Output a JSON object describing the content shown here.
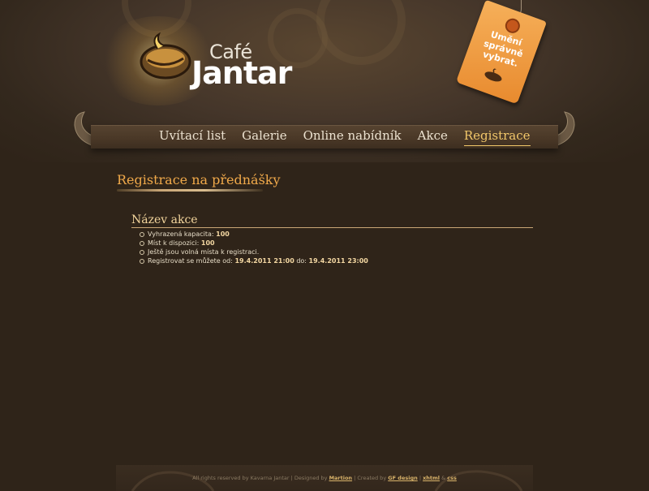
{
  "brand": {
    "small": "Café",
    "big": "Jantar"
  },
  "tag": {
    "line1": "Umění",
    "line2": "správně",
    "line3": "vybrat."
  },
  "nav": {
    "items": [
      {
        "label": "Uvítací list",
        "active": false
      },
      {
        "label": "Galerie",
        "active": false
      },
      {
        "label": "Online nabídník",
        "active": false
      },
      {
        "label": "Akce",
        "active": false
      },
      {
        "label": "Registrace",
        "active": true
      }
    ]
  },
  "main": {
    "page_title": "Registrace na přednášky",
    "event": {
      "title": "Název akce",
      "capacity_label": "Vyhrazená kapacita:",
      "capacity_value": "100",
      "free_label": "Míst k dispozici:",
      "free_value": "100",
      "status_text": "Ještě jsou volná místa k registraci.",
      "register_label": "Registrovat se můžete od:",
      "from_value": "19.4.2011 21:00",
      "to_label": "do:",
      "to_value": "19.4.2011 23:00"
    }
  },
  "footer": {
    "rights": "All rights reserved by Kavarna Jantar | Designed by",
    "designer": "Martion",
    "created_by": "| Created by",
    "creator": "GF design",
    "sep": "|",
    "xhtml": "xhtml",
    "amp": "&",
    "css": "css"
  },
  "colors": {
    "background": "#2f2419",
    "accent_orange": "#f0a94a",
    "active_nav": "#f2c76a",
    "tag_orange": "#f0a040"
  }
}
